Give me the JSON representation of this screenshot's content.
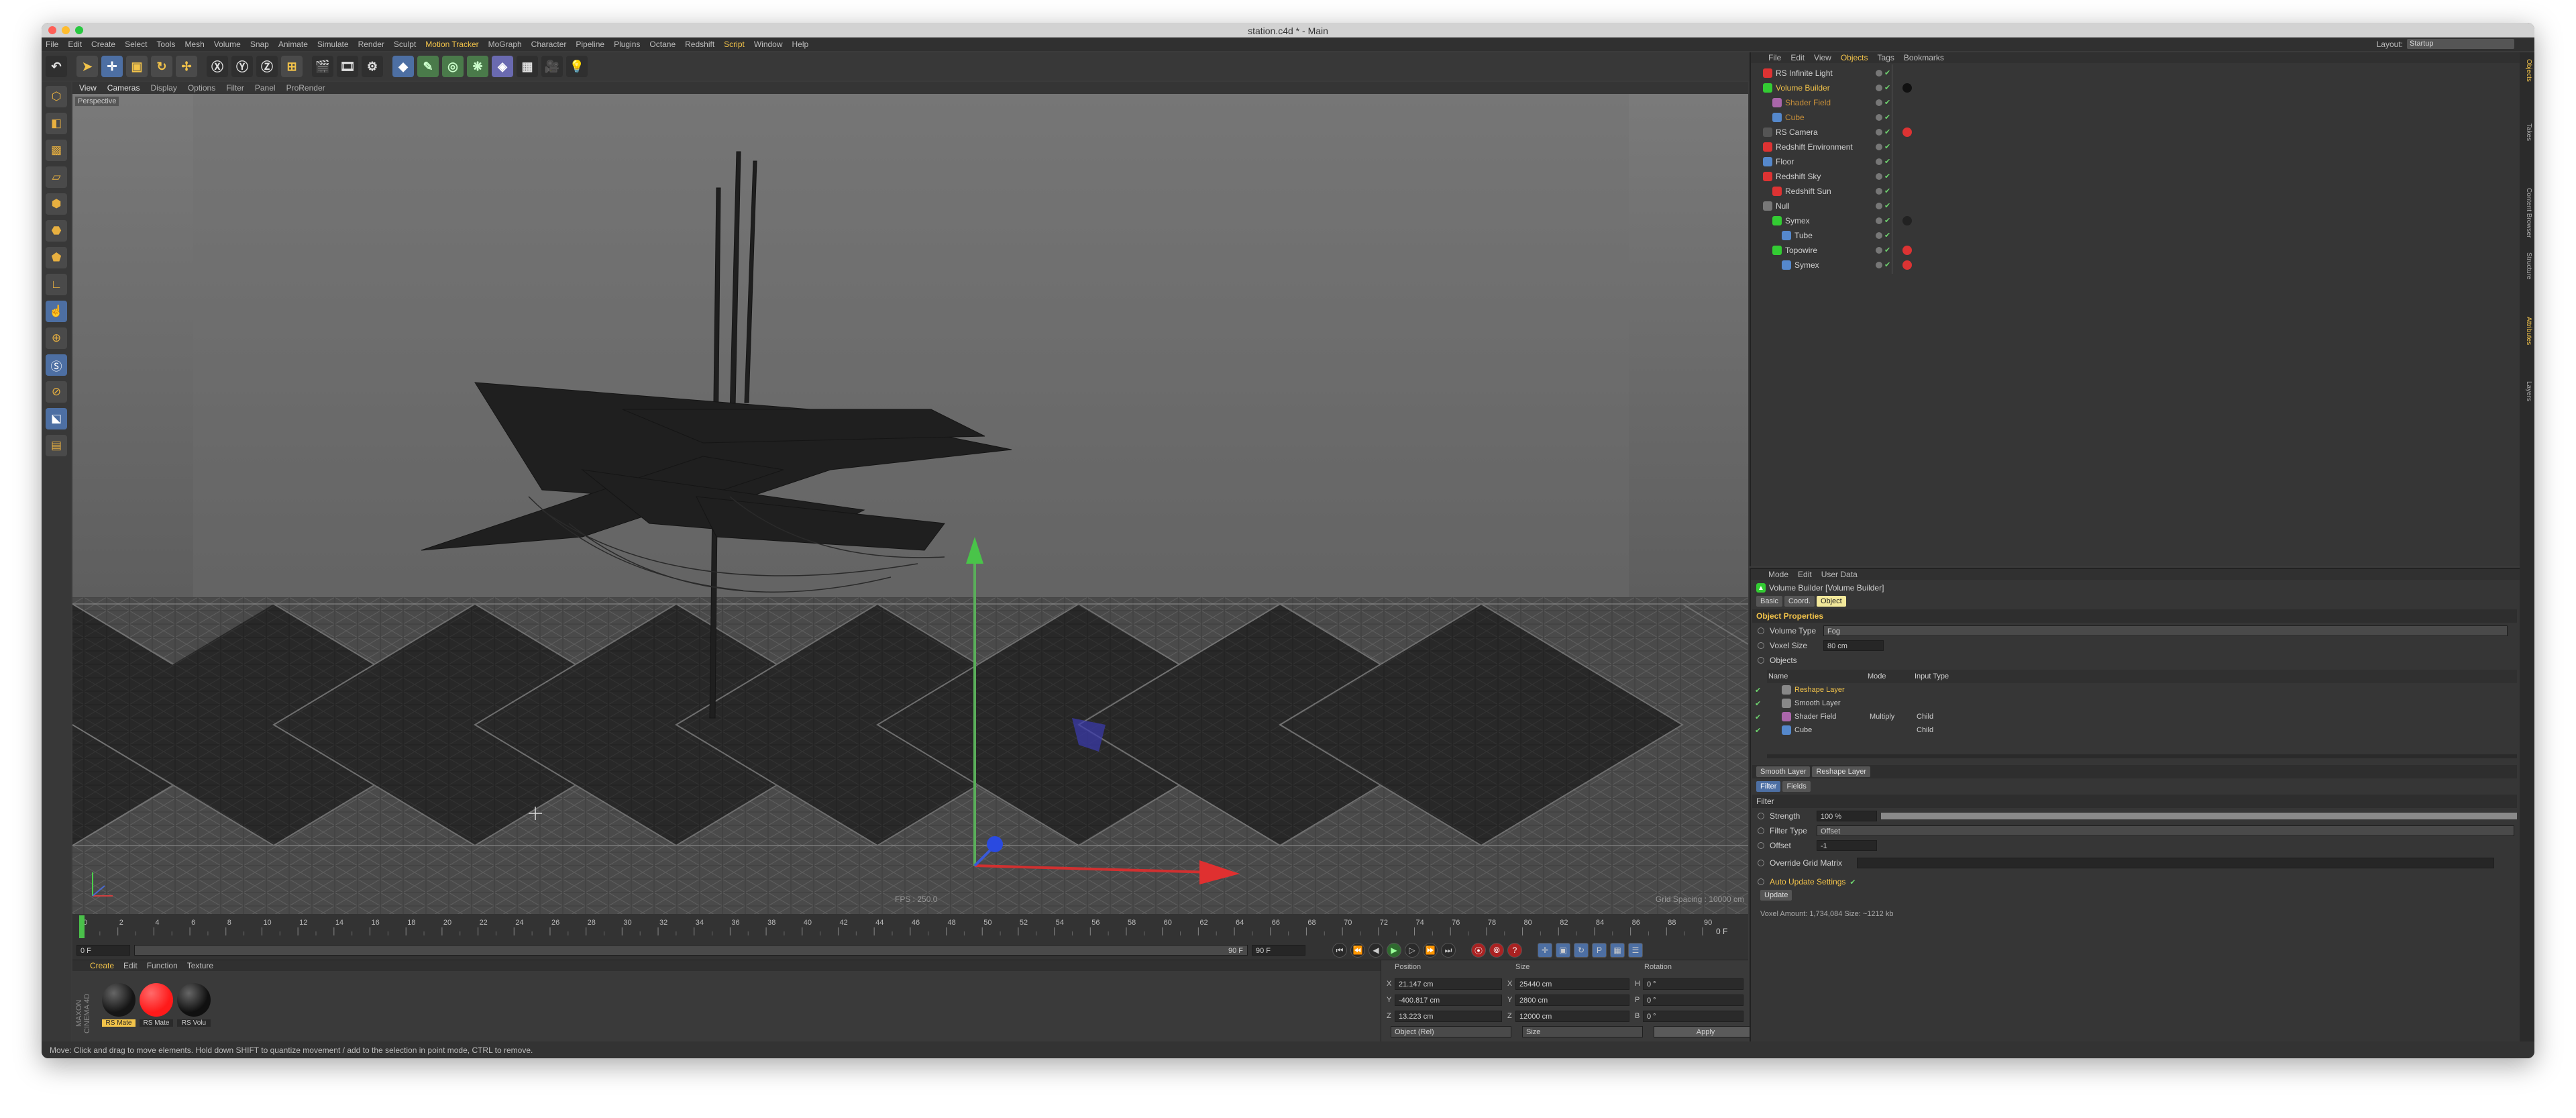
{
  "window": {
    "title": "station.c4d * - Main"
  },
  "menubar": {
    "items": [
      "File",
      "Edit",
      "Create",
      "Select",
      "Tools",
      "Mesh",
      "Volume",
      "Snap",
      "Animate",
      "Simulate",
      "Render",
      "Sculpt",
      "Motion Tracker",
      "MoGraph",
      "Character",
      "Pipeline",
      "Plugins",
      "Octane",
      "Redshift",
      "Script",
      "Window",
      "Help"
    ],
    "layout_label": "Layout:",
    "layout_value": "Startup"
  },
  "viewport": {
    "menu": [
      "View",
      "Cameras",
      "Display",
      "Options",
      "Filter",
      "Panel",
      "ProRender"
    ],
    "camera_label": "Perspective",
    "fps": "FPS : 250.0",
    "grid_spacing": "Grid Spacing : 10000 cm"
  },
  "timeline": {
    "ticks": [
      "0",
      "2",
      "4",
      "6",
      "8",
      "10",
      "12",
      "14",
      "16",
      "18",
      "20",
      "22",
      "24",
      "26",
      "28",
      "30",
      "32",
      "34",
      "36",
      "38",
      "40",
      "42",
      "44",
      "46",
      "48",
      "50",
      "52",
      "54",
      "56",
      "58",
      "60",
      "62",
      "64",
      "66",
      "68",
      "70",
      "72",
      "74",
      "76",
      "78",
      "80",
      "82",
      "84",
      "86",
      "88",
      "90"
    ],
    "current_frame": "0 F",
    "start_field": "0 F",
    "end_slider": "90 F",
    "end_field": "90 F",
    "right_field": "0 F",
    "playhead_fraction": 0
  },
  "materials": {
    "menu": [
      "Create",
      "Edit",
      "Function",
      "Texture"
    ],
    "items": [
      {
        "label": "RS Mate",
        "color": "#151515"
      },
      {
        "label": "RS Mate",
        "color": "#ff1a1a"
      },
      {
        "label": "RS Volu",
        "color": "#101010"
      }
    ]
  },
  "coordinates": {
    "headers": [
      "Position",
      "Size",
      "Rotation"
    ],
    "rows": [
      {
        "axis": "X",
        "pos": "21.147 cm",
        "size_axis": "X",
        "size": "25440 cm",
        "rot_axis": "H",
        "rot": "0 °"
      },
      {
        "axis": "Y",
        "pos": "-400.817 cm",
        "size_axis": "Y",
        "size": "2800 cm",
        "rot_axis": "P",
        "rot": "0 °"
      },
      {
        "axis": "Z",
        "pos": "13.223 cm",
        "size_axis": "Z",
        "size": "12000 cm",
        "rot_axis": "B",
        "rot": "0 °"
      }
    ],
    "mode": "Object (Rel)",
    "size_mode": "Size",
    "apply": "Apply"
  },
  "objects": {
    "menu": [
      "File",
      "Edit",
      "View",
      "Objects",
      "Tags",
      "Bookmarks"
    ],
    "items": [
      {
        "name": "RS Infinite Light",
        "indent": 0,
        "icon_color": "#d33",
        "style": "normal",
        "tag": ""
      },
      {
        "name": "Volume Builder",
        "indent": 0,
        "icon_color": "#3c3",
        "style": "sel",
        "tag": "#111"
      },
      {
        "name": "Shader Field",
        "indent": 1,
        "icon_color": "#a6a",
        "style": "dim",
        "tag": ""
      },
      {
        "name": "Cube",
        "indent": 1,
        "icon_color": "#58c",
        "style": "dim",
        "tag": ""
      },
      {
        "name": "RS Camera",
        "indent": 0,
        "icon_color": "#555",
        "style": "normal",
        "tag": "#d33"
      },
      {
        "name": "Redshift Environment",
        "indent": 0,
        "icon_color": "#d33",
        "style": "normal",
        "tag": ""
      },
      {
        "name": "Floor",
        "indent": 0,
        "icon_color": "#58c",
        "style": "normal",
        "tag": ""
      },
      {
        "name": "Redshift Sky",
        "indent": 0,
        "icon_color": "#d33",
        "style": "normal",
        "tag": ""
      },
      {
        "name": "Redshift Sun",
        "indent": 1,
        "icon_color": "#d33",
        "style": "normal",
        "tag": ""
      },
      {
        "name": "Null",
        "indent": 0,
        "icon_color": "#777",
        "style": "normal",
        "tag": ""
      },
      {
        "name": "Symex",
        "indent": 1,
        "icon_color": "#3c3",
        "style": "normal",
        "tag": "#222"
      },
      {
        "name": "Tube",
        "indent": 2,
        "icon_color": "#58c",
        "style": "normal",
        "tag": ""
      },
      {
        "name": "Topowire",
        "indent": 1,
        "icon_color": "#3c3",
        "style": "normal",
        "tag": "#d33"
      },
      {
        "name": "Symex",
        "indent": 2,
        "icon_color": "#58c",
        "style": "normal",
        "tag": "#d33"
      }
    ]
  },
  "attributes": {
    "menu": [
      "Mode",
      "Edit",
      "User Data"
    ],
    "object_title": "Volume Builder [Volume Builder]",
    "tabs": [
      "Basic",
      "Coord.",
      "Object"
    ],
    "section": "Object Properties",
    "volume_type_label": "Volume Type",
    "volume_type": "Fog",
    "voxel_size_label": "Voxel Size",
    "voxel_size": "80 cm",
    "objects_label": "Objects",
    "list_headers": [
      "Name",
      "Mode",
      "Input Type"
    ],
    "list": [
      {
        "name": "Reshape Layer",
        "mode": "",
        "input": "",
        "sel": true
      },
      {
        "name": "Smooth Layer",
        "mode": "",
        "input": "",
        "sel": false
      },
      {
        "name": "Shader Field",
        "mode": "Multiply",
        "input": "Child",
        "sel": false
      },
      {
        "name": "Cube",
        "mode": "",
        "input": "Child",
        "sel": false
      }
    ],
    "layer_tabs": [
      "Smooth Layer",
      "Reshape Layer"
    ],
    "sub_tabs": [
      "Filter",
      "Fields"
    ],
    "filter_section": "Filter",
    "strength_label": "Strength",
    "strength": "100 %",
    "strength_fraction": 1.0,
    "filter_type_label": "Filter Type",
    "filter_type": "Offset",
    "offset_label": "Offset",
    "offset": "-1",
    "override_label": "Override Grid Matrix",
    "auto_update_label": "Auto Update Settings",
    "update_button": "Update",
    "voxel_info": "Voxel Amount: 1,734,084   Size: ~1212 kb"
  },
  "side_tabs": [
    "Objects",
    "Takes",
    "Content Browser",
    "Structure",
    "Attributes",
    "Layers"
  ],
  "statusbar": {
    "text": "Move: Click and drag to move elements. Hold down SHIFT to quantize movement / add to the selection in point mode, CTRL to remove."
  }
}
